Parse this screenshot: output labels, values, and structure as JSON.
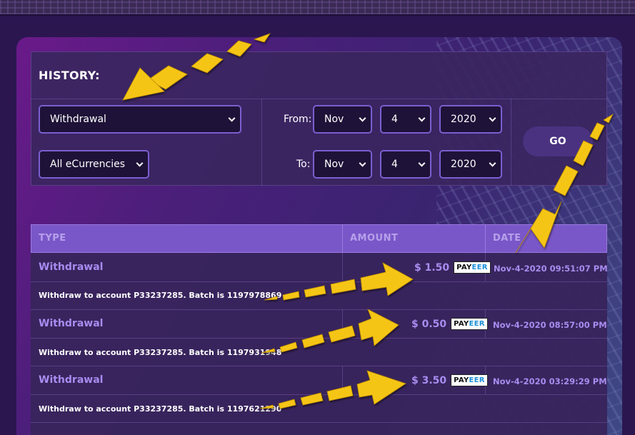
{
  "history": {
    "title": "HISTORY:"
  },
  "filters": {
    "type_value": "Withdrawal",
    "currency_value": "All eCurrencies",
    "from_label": "From:",
    "to_label": "To:",
    "from": {
      "month": "Nov",
      "day": "4",
      "year": "2020"
    },
    "to": {
      "month": "Nov",
      "day": "4",
      "year": "2020"
    },
    "go_label": "GO"
  },
  "table": {
    "headers": {
      "type": "TYPE",
      "amount": "AMOUNT",
      "date": "DATE"
    },
    "rows": [
      {
        "type": "Withdrawal",
        "amount": "$ 1.50",
        "method_a": "PAY",
        "method_b": "EER",
        "date": "Nov-4-2020 09:51:07 PM",
        "description": "Withdraw to account P33237285. Batch is 1197978869"
      },
      {
        "type": "Withdrawal",
        "amount": "$ 0.50",
        "method_a": "PAY",
        "method_b": "EER",
        "date": "Nov-4-2020 08:57:00 PM",
        "description": "Withdraw to account P33237285. Batch is 1197931948"
      },
      {
        "type": "Withdrawal",
        "amount": "$ 3.50",
        "method_a": "PAY",
        "method_b": "EER",
        "date": "Nov-4-2020 03:29:29 PM",
        "description": "Withdraw to account P33237285. Batch is 1197621290"
      }
    ]
  },
  "colors": {
    "accent": "#7a57c8",
    "text_accent": "#a98cf0",
    "arrow": "#f5c518"
  }
}
